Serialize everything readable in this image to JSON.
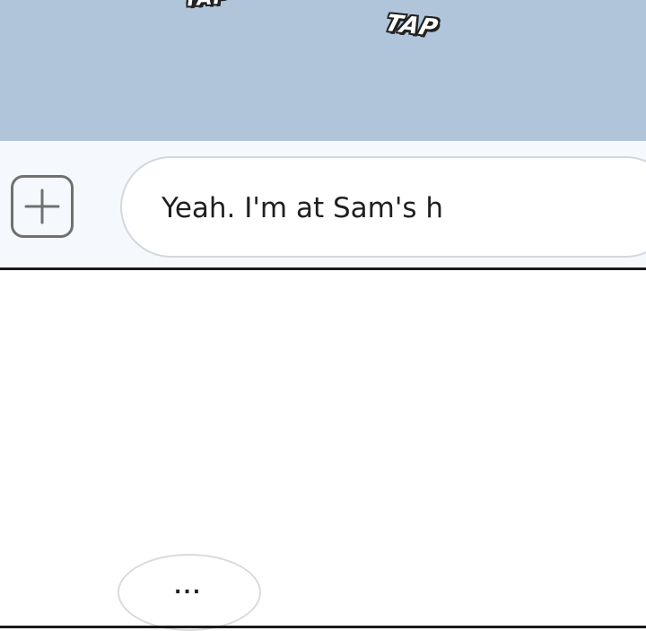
{
  "sound_effects": {
    "top_partial": "TAP",
    "tap": "TAP"
  },
  "composer": {
    "add_icon": "plus-square-icon",
    "message_value": "Yeah. I'm at Sam's h"
  },
  "typing_indicator": {
    "dots": "..."
  },
  "colors": {
    "panel_background": "#b0c5da",
    "input_bar_background": "#f5f8fc",
    "icon_stroke": "#707070"
  }
}
